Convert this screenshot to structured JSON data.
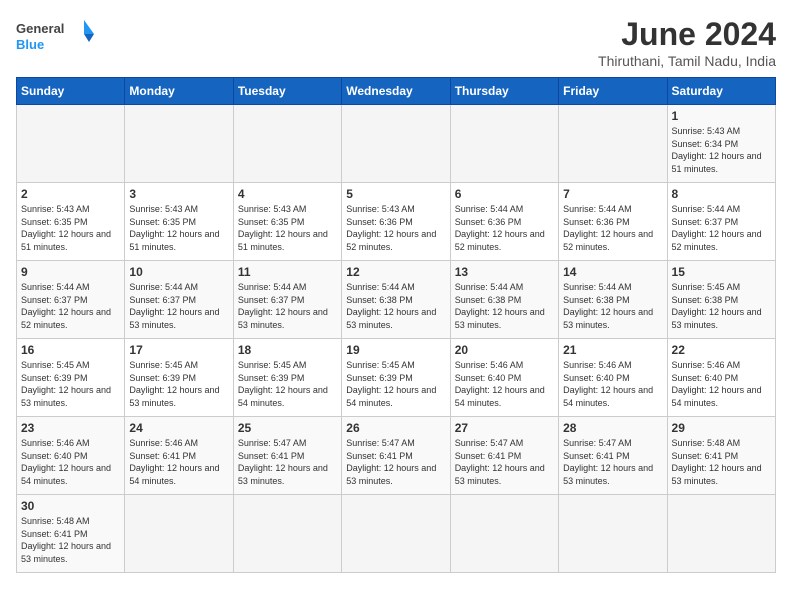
{
  "header": {
    "logo_general": "General",
    "logo_blue": "Blue",
    "title": "June 2024",
    "subtitle": "Thiruthani, Tamil Nadu, India"
  },
  "weekdays": [
    "Sunday",
    "Monday",
    "Tuesday",
    "Wednesday",
    "Thursday",
    "Friday",
    "Saturday"
  ],
  "days": [
    {
      "date": "",
      "info": ""
    },
    {
      "date": "",
      "info": ""
    },
    {
      "date": "",
      "info": ""
    },
    {
      "date": "",
      "info": ""
    },
    {
      "date": "",
      "info": ""
    },
    {
      "date": "",
      "info": ""
    },
    {
      "date": "1",
      "info": "Sunrise: 5:43 AM\nSunset: 6:34 PM\nDaylight: 12 hours\nand 51 minutes."
    },
    {
      "date": "2",
      "info": "Sunrise: 5:43 AM\nSunset: 6:35 PM\nDaylight: 12 hours\nand 51 minutes."
    },
    {
      "date": "3",
      "info": "Sunrise: 5:43 AM\nSunset: 6:35 PM\nDaylight: 12 hours\nand 51 minutes."
    },
    {
      "date": "4",
      "info": "Sunrise: 5:43 AM\nSunset: 6:35 PM\nDaylight: 12 hours\nand 51 minutes."
    },
    {
      "date": "5",
      "info": "Sunrise: 5:43 AM\nSunset: 6:36 PM\nDaylight: 12 hours\nand 52 minutes."
    },
    {
      "date": "6",
      "info": "Sunrise: 5:44 AM\nSunset: 6:36 PM\nDaylight: 12 hours\nand 52 minutes."
    },
    {
      "date": "7",
      "info": "Sunrise: 5:44 AM\nSunset: 6:36 PM\nDaylight: 12 hours\nand 52 minutes."
    },
    {
      "date": "8",
      "info": "Sunrise: 5:44 AM\nSunset: 6:37 PM\nDaylight: 12 hours\nand 52 minutes."
    },
    {
      "date": "9",
      "info": "Sunrise: 5:44 AM\nSunset: 6:37 PM\nDaylight: 12 hours\nand 52 minutes."
    },
    {
      "date": "10",
      "info": "Sunrise: 5:44 AM\nSunset: 6:37 PM\nDaylight: 12 hours\nand 53 minutes."
    },
    {
      "date": "11",
      "info": "Sunrise: 5:44 AM\nSunset: 6:37 PM\nDaylight: 12 hours\nand 53 minutes."
    },
    {
      "date": "12",
      "info": "Sunrise: 5:44 AM\nSunset: 6:38 PM\nDaylight: 12 hours\nand 53 minutes."
    },
    {
      "date": "13",
      "info": "Sunrise: 5:44 AM\nSunset: 6:38 PM\nDaylight: 12 hours\nand 53 minutes."
    },
    {
      "date": "14",
      "info": "Sunrise: 5:44 AM\nSunset: 6:38 PM\nDaylight: 12 hours\nand 53 minutes."
    },
    {
      "date": "15",
      "info": "Sunrise: 5:45 AM\nSunset: 6:38 PM\nDaylight: 12 hours\nand 53 minutes."
    },
    {
      "date": "16",
      "info": "Sunrise: 5:45 AM\nSunset: 6:39 PM\nDaylight: 12 hours\nand 53 minutes."
    },
    {
      "date": "17",
      "info": "Sunrise: 5:45 AM\nSunset: 6:39 PM\nDaylight: 12 hours\nand 53 minutes."
    },
    {
      "date": "18",
      "info": "Sunrise: 5:45 AM\nSunset: 6:39 PM\nDaylight: 12 hours\nand 54 minutes."
    },
    {
      "date": "19",
      "info": "Sunrise: 5:45 AM\nSunset: 6:39 PM\nDaylight: 12 hours\nand 54 minutes."
    },
    {
      "date": "20",
      "info": "Sunrise: 5:46 AM\nSunset: 6:40 PM\nDaylight: 12 hours\nand 54 minutes."
    },
    {
      "date": "21",
      "info": "Sunrise: 5:46 AM\nSunset: 6:40 PM\nDaylight: 12 hours\nand 54 minutes."
    },
    {
      "date": "22",
      "info": "Sunrise: 5:46 AM\nSunset: 6:40 PM\nDaylight: 12 hours\nand 54 minutes."
    },
    {
      "date": "23",
      "info": "Sunrise: 5:46 AM\nSunset: 6:40 PM\nDaylight: 12 hours\nand 54 minutes."
    },
    {
      "date": "24",
      "info": "Sunrise: 5:46 AM\nSunset: 6:41 PM\nDaylight: 12 hours\nand 54 minutes."
    },
    {
      "date": "25",
      "info": "Sunrise: 5:47 AM\nSunset: 6:41 PM\nDaylight: 12 hours\nand 53 minutes."
    },
    {
      "date": "26",
      "info": "Sunrise: 5:47 AM\nSunset: 6:41 PM\nDaylight: 12 hours\nand 53 minutes."
    },
    {
      "date": "27",
      "info": "Sunrise: 5:47 AM\nSunset: 6:41 PM\nDaylight: 12 hours\nand 53 minutes."
    },
    {
      "date": "28",
      "info": "Sunrise: 5:47 AM\nSunset: 6:41 PM\nDaylight: 12 hours\nand 53 minutes."
    },
    {
      "date": "29",
      "info": "Sunrise: 5:48 AM\nSunset: 6:41 PM\nDaylight: 12 hours\nand 53 minutes."
    },
    {
      "date": "30",
      "info": "Sunrise: 5:48 AM\nSunset: 6:41 PM\nDaylight: 12 hours\nand 53 minutes."
    },
    {
      "date": "",
      "info": ""
    },
    {
      "date": "",
      "info": ""
    },
    {
      "date": "",
      "info": ""
    },
    {
      "date": "",
      "info": ""
    },
    {
      "date": "",
      "info": ""
    },
    {
      "date": "",
      "info": ""
    }
  ]
}
